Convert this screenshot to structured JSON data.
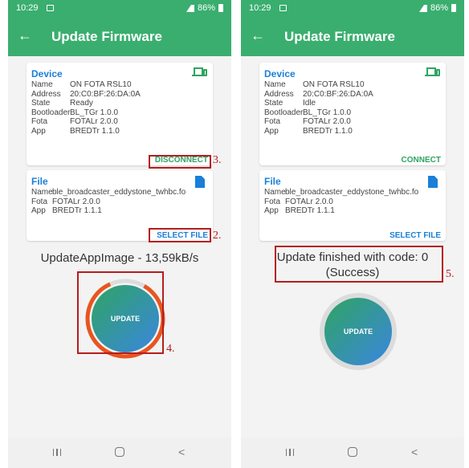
{
  "left_phone": {
    "status_bar": {
      "time": "10:29",
      "battery": "86%"
    },
    "app_bar": {
      "title": "Update Firmware"
    },
    "device_card": {
      "title": "Device",
      "rows": [
        {
          "label": "Name",
          "value": "ON FOTA RSL10"
        },
        {
          "label": "Address",
          "value": "20:C0:BF:26:DA:0A"
        },
        {
          "label": "State",
          "value": "Ready"
        },
        {
          "label": "Bootloader",
          "value": "BL_TGr 1.0.0"
        },
        {
          "label": "Fota",
          "value": "FOTALr 2.0.0"
        },
        {
          "label": "App",
          "value": "BREDTr 1.1.0"
        }
      ],
      "button": "DISCONNECT"
    },
    "file_card": {
      "title": "File",
      "rows": [
        {
          "label": "Name",
          "value": "ble_broadcaster_eddystone_twhbc.fo"
        },
        {
          "label": "Fota",
          "value": "FOTALr 2.0.0"
        },
        {
          "label": "App",
          "value": "BREDTr 1.1.1"
        }
      ],
      "button": "SELECT FILE"
    },
    "progress_text": "UpdateAppImage - 13,59kB/s",
    "progress_fraction": 0.85,
    "update_button": "UPDATE",
    "steps": {
      "disconnect": "3.",
      "select_file": "2.",
      "update": "4."
    }
  },
  "right_phone": {
    "status_bar": {
      "time": "10:29",
      "battery": "86%"
    },
    "app_bar": {
      "title": "Update Firmware"
    },
    "device_card": {
      "title": "Device",
      "rows": [
        {
          "label": "Name",
          "value": "ON FOTA RSL10"
        },
        {
          "label": "Address",
          "value": "20:C0:BF:26:DA:0A"
        },
        {
          "label": "State",
          "value": "Idle"
        },
        {
          "label": "Bootloader",
          "value": "BL_TGr 1.0.0"
        },
        {
          "label": "Fota",
          "value": "FOTALr 2.0.0"
        },
        {
          "label": "App",
          "value": "BREDTr 1.1.0"
        }
      ],
      "button": "CONNECT"
    },
    "file_card": {
      "title": "File",
      "rows": [
        {
          "label": "Name",
          "value": "ble_broadcaster_eddystone_twhbc.fo"
        },
        {
          "label": "Fota",
          "value": "FOTALr 2.0.0"
        },
        {
          "label": "App",
          "value": "BREDTr 1.1.1"
        }
      ],
      "button": "SELECT FILE"
    },
    "status_line1": "Update finished with code: 0",
    "status_line2": "(Success)",
    "update_button": "UPDATE",
    "steps": {
      "result": "5."
    }
  },
  "colors": {
    "primary": "#3aae6f",
    "accent_blue": "#1a7fd8",
    "annotation_red": "#b51d1d",
    "progress_orange": "#e8551f"
  }
}
